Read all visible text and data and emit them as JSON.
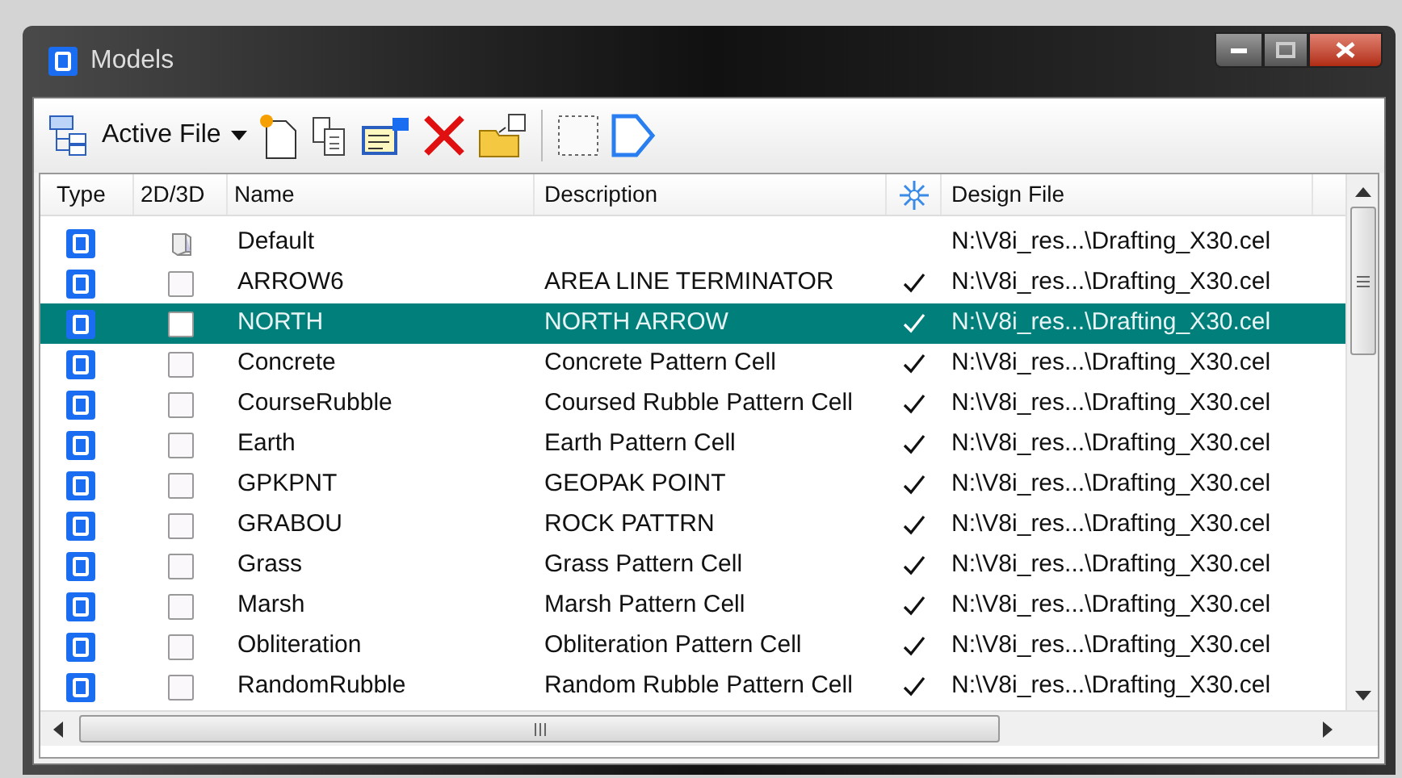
{
  "window": {
    "title": "Models"
  },
  "toolbar": {
    "source_label": "Active File"
  },
  "table": {
    "columns": [
      {
        "label": "Type"
      },
      {
        "label": "2D/3D"
      },
      {
        "label": "Name"
      },
      {
        "label": "Description"
      },
      {
        "kind": "icon"
      },
      {
        "label": "Design File"
      }
    ],
    "rows": [
      {
        "kind": "cube",
        "name": "Default",
        "description": "",
        "checked": false,
        "design_file": "N:\\V8i_res...\\Drafting_X30.cel",
        "selected": false
      },
      {
        "kind": "sheet",
        "name": "ARROW6",
        "description": "AREA LINE TERMINATOR",
        "checked": true,
        "design_file": "N:\\V8i_res...\\Drafting_X30.cel",
        "selected": false
      },
      {
        "kind": "sheet",
        "name": "NORTH",
        "description": "NORTH ARROW",
        "checked": true,
        "design_file": "N:\\V8i_res...\\Drafting_X30.cel",
        "selected": true
      },
      {
        "kind": "sheet",
        "name": "Concrete",
        "description": "Concrete Pattern Cell",
        "checked": true,
        "design_file": "N:\\V8i_res...\\Drafting_X30.cel",
        "selected": false
      },
      {
        "kind": "sheet",
        "name": "CourseRubble",
        "description": "Coursed Rubble Pattern Cell",
        "checked": true,
        "design_file": "N:\\V8i_res...\\Drafting_X30.cel",
        "selected": false
      },
      {
        "kind": "sheet",
        "name": "Earth",
        "description": "Earth Pattern Cell",
        "checked": true,
        "design_file": "N:\\V8i_res...\\Drafting_X30.cel",
        "selected": false
      },
      {
        "kind": "sheet",
        "name": "GPKPNT",
        "description": "GEOPAK POINT",
        "checked": true,
        "design_file": "N:\\V8i_res...\\Drafting_X30.cel",
        "selected": false
      },
      {
        "kind": "sheet",
        "name": "GRABOU",
        "description": "ROCK PATTRN",
        "checked": true,
        "design_file": "N:\\V8i_res...\\Drafting_X30.cel",
        "selected": false
      },
      {
        "kind": "sheet",
        "name": "Grass",
        "description": "Grass Pattern Cell",
        "checked": true,
        "design_file": "N:\\V8i_res...\\Drafting_X30.cel",
        "selected": false
      },
      {
        "kind": "sheet",
        "name": "Marsh",
        "description": "Marsh Pattern Cell",
        "checked": true,
        "design_file": "N:\\V8i_res...\\Drafting_X30.cel",
        "selected": false
      },
      {
        "kind": "sheet",
        "name": "Obliteration",
        "description": "Obliteration Pattern Cell",
        "checked": true,
        "design_file": "N:\\V8i_res...\\Drafting_X30.cel",
        "selected": false
      },
      {
        "kind": "sheet",
        "name": "RandomRubble",
        "description": "Random Rubble Pattern Cell",
        "checked": true,
        "design_file": "N:\\V8i_res...\\Drafting_X30.cel",
        "selected": false
      }
    ]
  }
}
